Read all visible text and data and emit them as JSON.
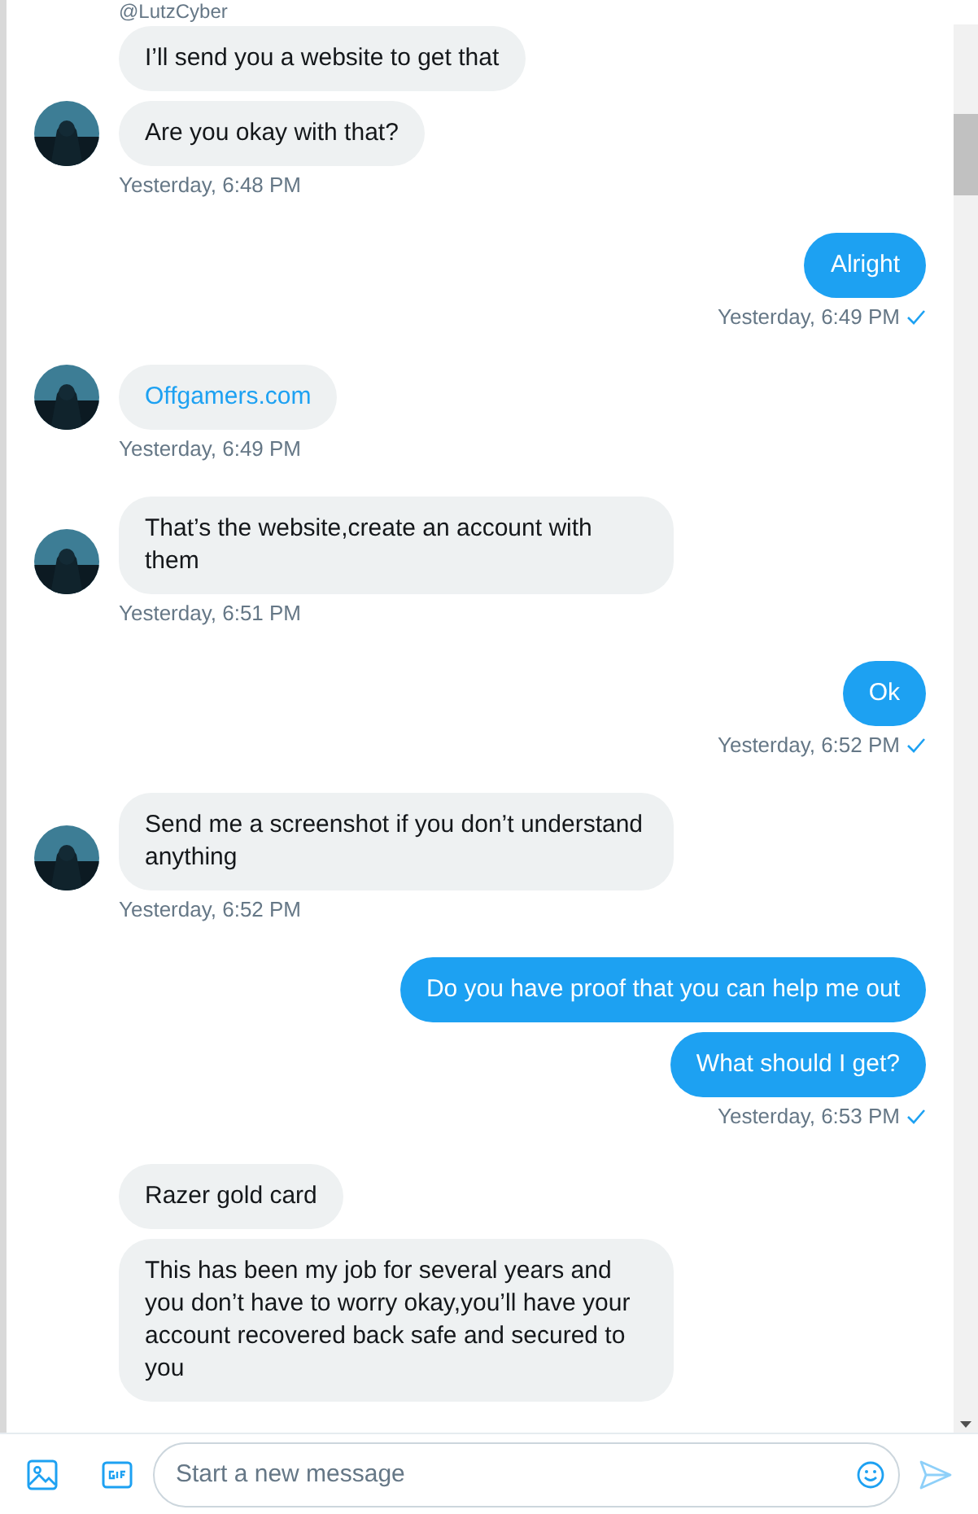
{
  "header": {
    "handle": "@LutzCyber"
  },
  "groups": [
    {
      "kind": "incoming",
      "messages": [
        {
          "kind": "text",
          "text": "I’ll send you a website to get that"
        },
        {
          "kind": "text",
          "text": "Are you okay with that?"
        }
      ],
      "time": "Yesterday, 6:48 PM"
    },
    {
      "kind": "outgoing",
      "messages": [
        {
          "kind": "text",
          "text": "Alright"
        }
      ],
      "time": "Yesterday, 6:49 PM",
      "read": true
    },
    {
      "kind": "incoming",
      "messages": [
        {
          "kind": "link",
          "text": "Offgamers.com"
        }
      ],
      "time": "Yesterday, 6:49 PM"
    },
    {
      "kind": "incoming",
      "messages": [
        {
          "kind": "text",
          "text": "That’s the website,create an account with them"
        }
      ],
      "time": "Yesterday, 6:51 PM"
    },
    {
      "kind": "outgoing",
      "messages": [
        {
          "kind": "text",
          "text": "Ok"
        }
      ],
      "time": "Yesterday, 6:52 PM",
      "read": true
    },
    {
      "kind": "incoming",
      "messages": [
        {
          "kind": "text",
          "text": "Send me a screenshot if you don’t understand anything"
        }
      ],
      "time": "Yesterday, 6:52 PM"
    },
    {
      "kind": "outgoing",
      "messages": [
        {
          "kind": "text",
          "text": "Do you have proof that you can help me out"
        },
        {
          "kind": "text",
          "text": "What should I get?"
        }
      ],
      "time": "Yesterday, 6:53 PM",
      "read": true
    },
    {
      "kind": "incoming",
      "messages": [
        {
          "kind": "text",
          "text": "Razer gold card"
        },
        {
          "kind": "text",
          "text": "This has been my job for several years and you don’t have to worry okay,you’ll have your account recovered back safe and secured to you"
        }
      ]
    }
  ],
  "composer": {
    "placeholder": "Start a new message"
  }
}
